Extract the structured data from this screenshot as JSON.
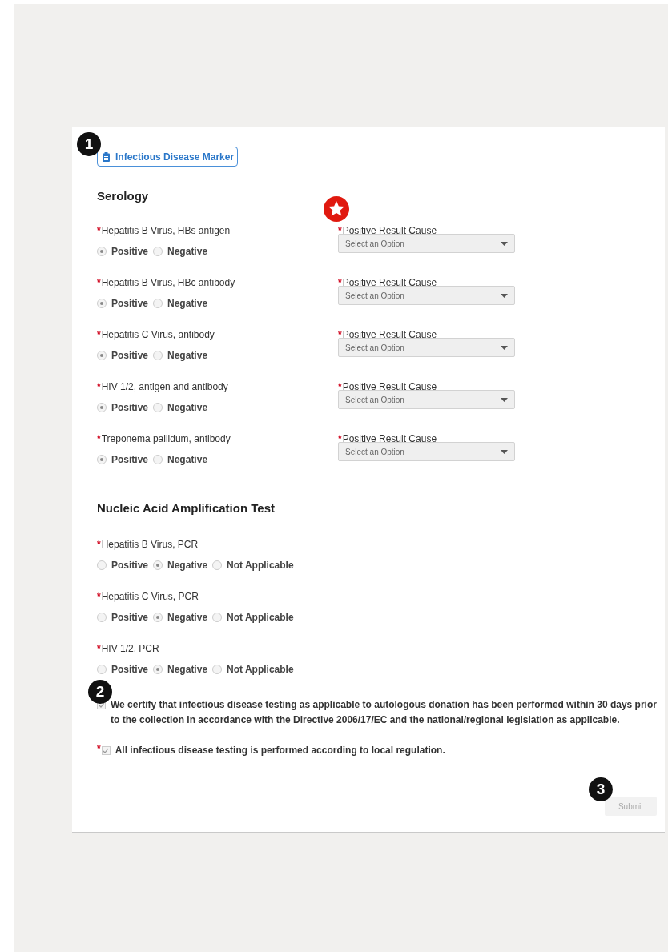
{
  "section_button": {
    "label": "Infectious Disease Marker",
    "marker": "1"
  },
  "serology": {
    "title": "Serology",
    "rows": [
      {
        "label": "Hepatitis B Virus, HBs antigen",
        "required_mark": "*",
        "options": [
          {
            "label": "Positive",
            "selected": true
          },
          {
            "label": "Negative",
            "selected": false
          }
        ],
        "cause": {
          "label": "Positive Result Cause",
          "required_mark": "*",
          "placeholder": "Select an Option",
          "starred": true
        }
      },
      {
        "label": "Hepatitis B Virus, HBc antibody",
        "required_mark": "*",
        "options": [
          {
            "label": "Positive",
            "selected": true
          },
          {
            "label": "Negative",
            "selected": false
          }
        ],
        "cause": {
          "label": "Positive Result Cause",
          "required_mark": "*",
          "placeholder": "Select an Option"
        }
      },
      {
        "label": "Hepatitis C Virus, antibody",
        "required_mark": "*",
        "options": [
          {
            "label": "Positive",
            "selected": true
          },
          {
            "label": "Negative",
            "selected": false
          }
        ],
        "cause": {
          "label": "Positive Result Cause",
          "required_mark": "*",
          "placeholder": "Select an Option"
        }
      },
      {
        "label": "HIV 1/2, antigen and antibody",
        "required_mark": "*",
        "options": [
          {
            "label": "Positive",
            "selected": true
          },
          {
            "label": "Negative",
            "selected": false
          }
        ],
        "cause": {
          "label": "Positive Result Cause",
          "required_mark": "*",
          "placeholder": "Select an Option"
        }
      },
      {
        "label": "Treponema pallidum, antibody",
        "required_mark": "*",
        "options": [
          {
            "label": "Positive",
            "selected": true
          },
          {
            "label": "Negative",
            "selected": false
          }
        ],
        "cause": {
          "label": "Positive Result Cause",
          "required_mark": "*",
          "placeholder": "Select an Option"
        }
      }
    ]
  },
  "naat": {
    "title": "Nucleic Acid Amplification Test",
    "rows": [
      {
        "label": "Hepatitis B Virus, PCR",
        "required_mark": "*",
        "options": [
          {
            "label": "Positive",
            "selected": false
          },
          {
            "label": "Negative",
            "selected": true
          },
          {
            "label": "Not Applicable",
            "selected": false
          }
        ]
      },
      {
        "label": "Hepatitis C Virus, PCR",
        "required_mark": "*",
        "options": [
          {
            "label": "Positive",
            "selected": false
          },
          {
            "label": "Negative",
            "selected": true
          },
          {
            "label": "Not Applicable",
            "selected": false
          }
        ]
      },
      {
        "label": "HIV 1/2, PCR",
        "required_mark": "*",
        "options": [
          {
            "label": "Positive",
            "selected": false
          },
          {
            "label": "Negative",
            "selected": true
          },
          {
            "label": "Not Applicable",
            "selected": false
          }
        ]
      }
    ]
  },
  "certifications": [
    {
      "text": "We certify that infectious disease testing as applicable to autologous donation has been performed within 30 days prior to the collection in accordance with the Directive 2006/17/EC and the national/regional legislation as applicable.",
      "checked": true,
      "marker": "2"
    },
    {
      "text": "All infectious disease testing is performed according to local regulation.",
      "required_mark": "*",
      "checked": true
    }
  ],
  "submit": {
    "label": "Submit",
    "disabled": true,
    "marker": "3"
  }
}
